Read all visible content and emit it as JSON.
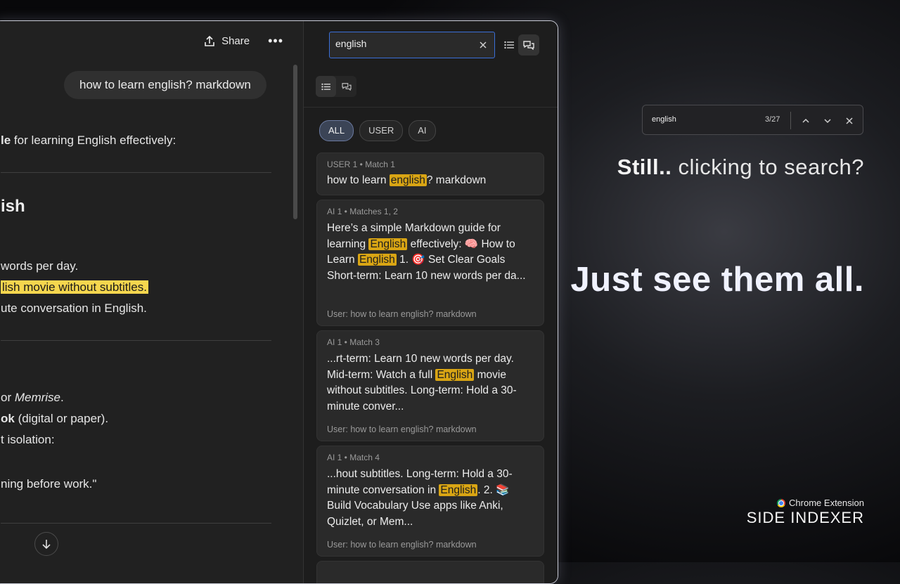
{
  "chat": {
    "share_label": "Share",
    "more_label": "•••",
    "user_message": "how to learn english? markdown",
    "lines": {
      "intro_bold": "le",
      "intro_rest": " for learning English effectively:",
      "heading": "ish",
      "l1": "words per day.",
      "l2": "lish movie without subtitles.",
      "l3": "ute conversation in English.",
      "l4_pre": " or ",
      "l4_em": "Memrise",
      "l4_post": ".",
      "l5_bold": "ok",
      "l5_rest": " (digital or paper).",
      "l6": "t isolation:",
      "l7": "ning before work.\""
    }
  },
  "panel": {
    "search": {
      "value": "english"
    },
    "filters": [
      "ALL",
      "USER",
      "AI"
    ],
    "cards": [
      {
        "meta": "USER 1 • Match 1",
        "pre": "how to learn ",
        "hl": "english",
        "post": "? markdown"
      },
      {
        "meta": "AI 1 • Matches 1, 2",
        "t1": "Here’s a simple Markdown guide for learning ",
        "h1": "English",
        "t2": " effectively: 🧠 How to Learn ",
        "h2": "English",
        "t3": " 1. 🎯 Set Clear Goals Short-term: Learn 10 new words per da...",
        "foot": "User: how to learn english? markdown"
      },
      {
        "meta": "AI 1 • Match 3",
        "t1": "...rt-term: Learn 10 new words per day. Mid-term: Watch a full ",
        "h1": "English",
        "t2": " movie without subtitles. Long-term: Hold a 30-minute conver...",
        "foot": "User: how to learn english? markdown"
      },
      {
        "meta": "AI 1 • Match 4",
        "t1": "...hout subtitles. Long-term: Hold a 30-minute conversation in ",
        "h1": "English",
        "t2": ". 2. 📚 Build Vocabulary Use apps like Anki, Quizlet, or Mem...",
        "foot": "User: how to learn english? markdown"
      }
    ]
  },
  "findbar": {
    "query": "english",
    "count": "3/27"
  },
  "promo": {
    "line1_bold": "Still..",
    "line1_rest": " clicking to search?",
    "line2": "Just see them all.",
    "brand_sub": "Chrome Extension",
    "brand": "SIDE INDEXER"
  },
  "colors": {
    "highlight": "#d9a514",
    "focus_border": "#3a6fd8",
    "active_pill": "#3b4456"
  }
}
